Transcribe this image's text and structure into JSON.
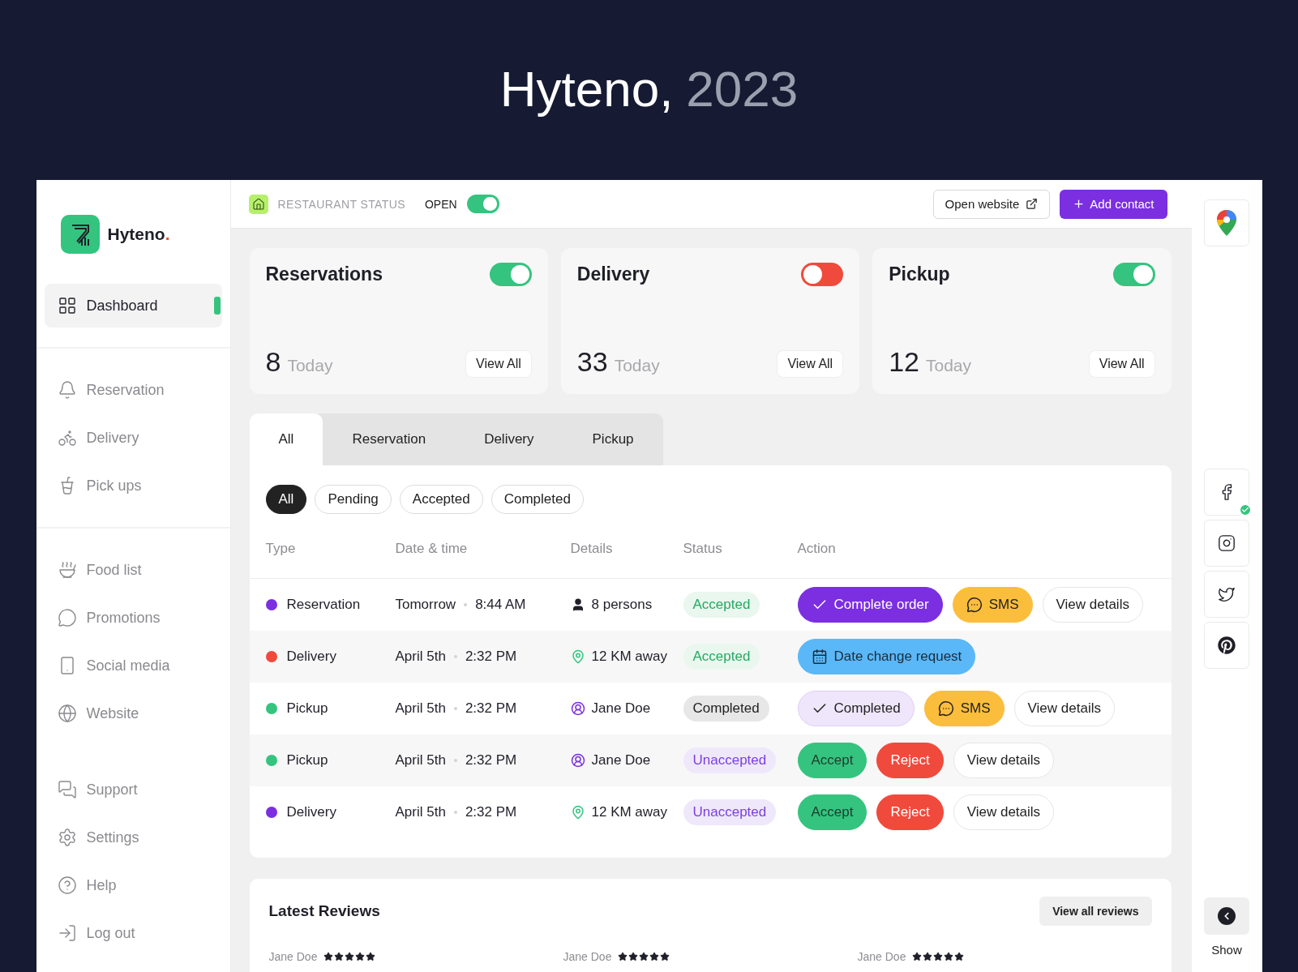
{
  "header": {
    "title": "Hyteno,",
    "year": "2023"
  },
  "brand": {
    "name": "Hyteno",
    "mark": "."
  },
  "sidebar": {
    "groups": [
      [
        {
          "label": "Dashboard",
          "selected": true
        }
      ],
      [
        {
          "label": "Reservation",
          "selected": false
        },
        {
          "label": "Delivery",
          "selected": false
        },
        {
          "label": "Pick ups",
          "selected": false
        }
      ],
      [
        {
          "label": "Food list",
          "selected": false
        },
        {
          "label": "Promotions",
          "selected": false
        },
        {
          "label": "Social media",
          "selected": false
        },
        {
          "label": "Website",
          "selected": false
        }
      ],
      [
        {
          "label": "Support",
          "selected": false
        },
        {
          "label": "Settings",
          "selected": false
        },
        {
          "label": "Help",
          "selected": false
        },
        {
          "label": "Log out",
          "selected": false
        }
      ]
    ]
  },
  "topbar": {
    "status_label": "RESTAURANT STATUS",
    "status_value": "OPEN",
    "on": true,
    "open_website": "Open website",
    "add_contact": "Add contact"
  },
  "cards": [
    {
      "title": "Reservations",
      "on": true,
      "count": "8",
      "unit": "Today",
      "button": "View All"
    },
    {
      "title": "Delivery",
      "on": false,
      "count": "33",
      "unit": "Today",
      "button": "View All"
    },
    {
      "title": "Pickup",
      "on": true,
      "count": "12",
      "unit": "Today",
      "button": "View All"
    }
  ],
  "tabs": [
    {
      "label": "All",
      "selected": true
    },
    {
      "label": "Reservation",
      "selected": false
    },
    {
      "label": "Delivery",
      "selected": false
    },
    {
      "label": "Pickup",
      "selected": false
    }
  ],
  "filters": [
    {
      "label": "All",
      "selected": true
    },
    {
      "label": "Pending",
      "selected": false
    },
    {
      "label": "Accepted",
      "selected": false
    },
    {
      "label": "Completed",
      "selected": false
    }
  ],
  "table": {
    "columns": [
      "Type",
      "Date & time",
      "Details",
      "Status",
      "Action"
    ],
    "rows": [
      {
        "type": "Reservation",
        "color": "#7b2fe0",
        "date": "Tomorrow",
        "time": "8:44 AM",
        "details": {
          "kind": "persons",
          "text": "8 persons"
        },
        "status": {
          "kind": "accepted",
          "label": "Accepted"
        },
        "actions": [
          {
            "kind": "complete",
            "label": "Complete order"
          },
          {
            "kind": "sms",
            "label": "SMS"
          },
          {
            "kind": "details",
            "label": "View details"
          }
        ]
      },
      {
        "type": "Delivery",
        "color": "#f04a3c",
        "date": "April 5th",
        "time": "2:32 PM",
        "details": {
          "kind": "location",
          "text": "12 KM away"
        },
        "status": {
          "kind": "accepted",
          "label": "Accepted"
        },
        "actions": [
          {
            "kind": "date",
            "label": "Date change request"
          }
        ]
      },
      {
        "type": "Pickup",
        "color": "#34c47f",
        "date": "April 5th",
        "time": "2:32 PM",
        "details": {
          "kind": "user",
          "text": "Jane Doe"
        },
        "status": {
          "kind": "completed",
          "label": "Completed"
        },
        "actions": [
          {
            "kind": "completed",
            "label": "Completed"
          },
          {
            "kind": "sms",
            "label": "SMS"
          },
          {
            "kind": "details",
            "label": "View details"
          }
        ]
      },
      {
        "type": "Pickup",
        "color": "#34c47f",
        "date": "April 5th",
        "time": "2:32 PM",
        "details": {
          "kind": "user",
          "text": "Jane Doe"
        },
        "status": {
          "kind": "unaccepted",
          "label": "Unaccepted"
        },
        "actions": [
          {
            "kind": "accept",
            "label": "Accept"
          },
          {
            "kind": "reject",
            "label": "Reject"
          },
          {
            "kind": "details",
            "label": "View details"
          }
        ]
      },
      {
        "type": "Delivery",
        "color": "#7b2fe0",
        "date": "April 5th",
        "time": "2:32 PM",
        "details": {
          "kind": "location",
          "text": "12 KM away"
        },
        "status": {
          "kind": "unaccepted",
          "label": "Unaccepted"
        },
        "actions": [
          {
            "kind": "accept",
            "label": "Accept"
          },
          {
            "kind": "reject",
            "label": "Reject"
          },
          {
            "kind": "details",
            "label": "View details"
          }
        ]
      }
    ]
  },
  "reviews": {
    "title": "Latest Reviews",
    "button": "View all reviews",
    "items": [
      {
        "name": "Jane Doe",
        "stars": 5
      },
      {
        "name": "Jane Doe",
        "stars": 5
      },
      {
        "name": "Jane Doe",
        "stars": 5
      }
    ]
  },
  "rail": {
    "social_connected": [
      true,
      false,
      false,
      false
    ],
    "show_label": "Show"
  }
}
